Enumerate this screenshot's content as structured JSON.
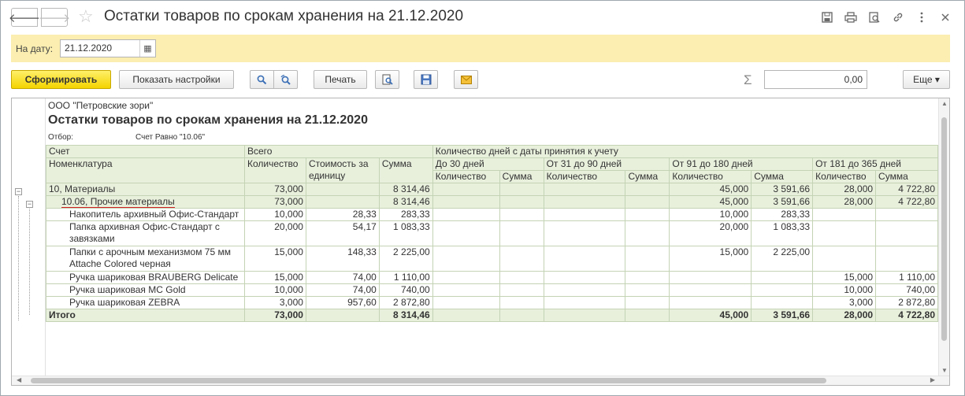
{
  "window": {
    "title": "Остатки товаров по срокам хранения на 21.12.2020",
    "back": "🡐",
    "forward": "🡒",
    "star": "☆",
    "icons": [
      "save-icon",
      "print-icon",
      "preview-icon",
      "link-icon",
      "more-icon",
      "close-icon"
    ]
  },
  "filter": {
    "date_label": "На дату:",
    "date_value": "21.12.2020",
    "calendar_glyph": "▦"
  },
  "toolbar": {
    "generate": "Сформировать",
    "show_settings": "Показать настройки",
    "print": "Печать",
    "search_glyph": "🔍",
    "search_next_glyph": "🔍",
    "preview_glyph": "🔍",
    "save_glyph": "🖫",
    "mail_glyph": "✉",
    "sigma": "Σ",
    "sum_value": "0,00",
    "more": "Еще ▾"
  },
  "report": {
    "org": "ООО \"Петровские зори\"",
    "title": "Остатки товаров по срокам хранения на 21.12.2020",
    "filter_label": "Отбор:",
    "filter_value": "Счет Равно \"10.06\"",
    "headers": {
      "account": "Счет",
      "nomenclature": "Номенклатура",
      "total": "Всего",
      "days_group": "Количество дней с даты принятия к учету",
      "qty": "Количество",
      "unit_cost": "Стоимость за единицу",
      "sum": "Сумма",
      "p1": "До 30 дней",
      "p2": "От 31 до 90 дней",
      "p3": "От 91 до 180 дней",
      "p4": "От 181 до 365 дней"
    },
    "rows": [
      {
        "type": "group",
        "name": "10, Материалы",
        "qty": "73,000",
        "unit": "",
        "sum": "8 314,46",
        "q1": "",
        "s1": "",
        "q2": "",
        "s2": "",
        "q3": "45,000",
        "s3": "3 591,66",
        "q4": "28,000",
        "s4": "4 722,80"
      },
      {
        "type": "subgroup",
        "name": "10.06, Прочие материалы",
        "qty": "73,000",
        "unit": "",
        "sum": "8 314,46",
        "q1": "",
        "s1": "",
        "q2": "",
        "s2": "",
        "q3": "45,000",
        "s3": "3 591,66",
        "q4": "28,000",
        "s4": "4 722,80"
      },
      {
        "type": "item",
        "name": "Накопитель архивный Офис-Стандарт",
        "qty": "10,000",
        "unit": "28,33",
        "sum": "283,33",
        "q1": "",
        "s1": "",
        "q2": "",
        "s2": "",
        "q3": "10,000",
        "s3": "283,33",
        "q4": "",
        "s4": ""
      },
      {
        "type": "item2",
        "name": "Папка архивная Офис-Стандарт с завязками",
        "qty": "20,000",
        "unit": "54,17",
        "sum": "1 083,33",
        "q1": "",
        "s1": "",
        "q2": "",
        "s2": "",
        "q3": "20,000",
        "s3": "1 083,33",
        "q4": "",
        "s4": ""
      },
      {
        "type": "item2",
        "name": "Папки с арочным механизмом 75 мм Attache Colored черная",
        "qty": "15,000",
        "unit": "148,33",
        "sum": "2 225,00",
        "q1": "",
        "s1": "",
        "q2": "",
        "s2": "",
        "q3": "15,000",
        "s3": "2 225,00",
        "q4": "",
        "s4": ""
      },
      {
        "type": "item",
        "name": "Ручка шариковая BRAUBERG Delicate",
        "qty": "15,000",
        "unit": "74,00",
        "sum": "1 110,00",
        "q1": "",
        "s1": "",
        "q2": "",
        "s2": "",
        "q3": "",
        "s3": "",
        "q4": "15,000",
        "s4": "1 110,00"
      },
      {
        "type": "item",
        "name": "Ручка шариковая MC Gold",
        "qty": "10,000",
        "unit": "74,00",
        "sum": "740,00",
        "q1": "",
        "s1": "",
        "q2": "",
        "s2": "",
        "q3": "",
        "s3": "",
        "q4": "10,000",
        "s4": "740,00"
      },
      {
        "type": "item",
        "name": "Ручка шариковая ZEBRA",
        "qty": "3,000",
        "unit": "957,60",
        "sum": "2 872,80",
        "q1": "",
        "s1": "",
        "q2": "",
        "s2": "",
        "q3": "",
        "s3": "",
        "q4": "3,000",
        "s4": "2 872,80"
      },
      {
        "type": "total",
        "name": "Итого",
        "qty": "73,000",
        "unit": "",
        "sum": "8 314,46",
        "q1": "",
        "s1": "",
        "q2": "",
        "s2": "",
        "q3": "45,000",
        "s3": "3 591,66",
        "q4": "28,000",
        "s4": "4 722,80"
      }
    ]
  },
  "colors": {
    "header_bg": "#e8f0dc",
    "date_panel_bg": "#fbeeb0",
    "primary_button": "#f4d300",
    "underline": "#d01f1f"
  }
}
